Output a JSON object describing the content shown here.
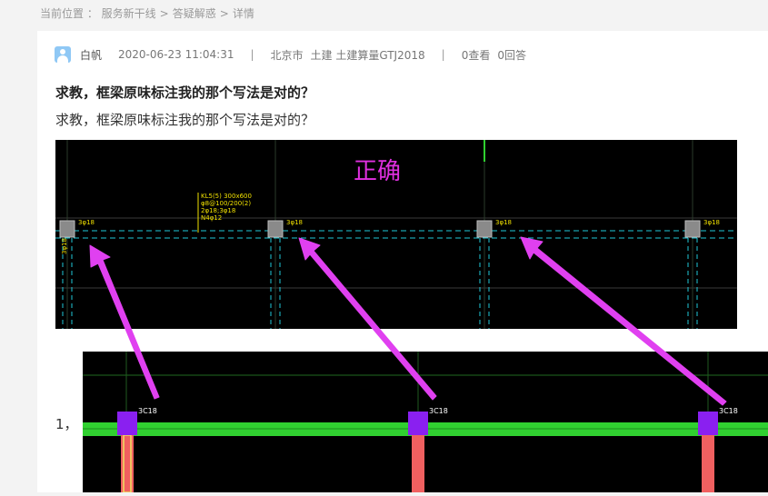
{
  "breadcrumb": {
    "prefix": "当前位置 ：",
    "items": [
      "服务新干线",
      "答疑解惑",
      "详情"
    ],
    "separator": ">"
  },
  "post": {
    "user": "白帆",
    "time": "2020-06-23 11:04:31",
    "divider": "|",
    "city": "北京市",
    "category": "土建 土建算量GTJ2018",
    "views": "0查看",
    "answers": "0回答",
    "title": "求教，框梁原味标注我的那个写法是对的？",
    "body": "求教，框梁原味标注我的那个写法是对的？",
    "list_number": "1，"
  },
  "image1": {
    "caption": "正确",
    "beam_note_lines": [
      "KL5(5) 300x600",
      "φ8@100/200(2)",
      "2φ18;3φ18",
      "N4φ12"
    ],
    "column_labels": [
      "3φ18",
      "3φ18",
      "3φ18",
      "3φ18"
    ],
    "side_label": "3φ18"
  },
  "image2": {
    "column_labels": [
      "3C18",
      "3C18",
      "3C18"
    ]
  },
  "colors": {
    "annotation_arrow": "#e040f0",
    "caption": "#e030e0",
    "cad_yellow": "#f0e000",
    "cad_cyan": "#20c8d8",
    "column_purple": "#8a20f0",
    "beam_green": "#30d030",
    "column_red": "#f06060"
  }
}
